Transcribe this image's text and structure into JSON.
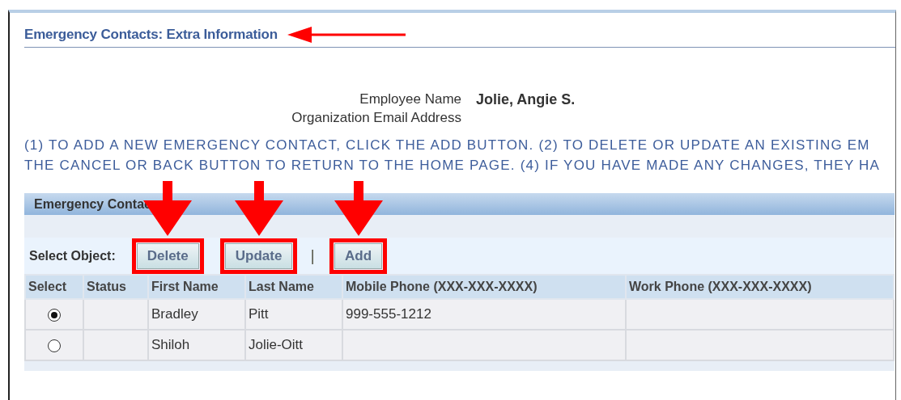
{
  "title": {
    "text": "Emergency Contacts: Extra Information",
    "highlighted": true
  },
  "employee": [
    {
      "label": "Employee Name",
      "value": "Jolie, Angie S."
    },
    {
      "label": "Organization Email Address"
    }
  ],
  "instructions": [
    "(1) TO ADD A NEW EMERGENCY CONTACT, CLICK THE ADD BUTTON. (2) TO DELETE OR UPDATE AN EXISTING EM",
    "THE CANCEL OR BACK BUTTON TO RETURN TO THE HOME PAGE. (4) IF YOU HAVE MADE ANY CHANGES, THEY HA"
  ],
  "section": {
    "title": "Emergency Contac"
  },
  "toolbar": {
    "label": "Select Object:",
    "buttons": [
      {
        "label": "Delete",
        "highlighted": true
      },
      {
        "label": "Update",
        "highlighted": true
      },
      {
        "label": "Add",
        "highlighted": true
      }
    ],
    "separator": "|"
  },
  "table": {
    "columns": [
      "Select",
      "Status",
      "First Name",
      "Last Name",
      "Mobile Phone (XXX-XXX-XXXX)",
      "Work Phone (XXX-XXX-XXXX)"
    ],
    "rows": [
      {
        "selected": true,
        "first_name": "Bradley",
        "last_name": "Pitt",
        "mobile": "999-555-1212"
      },
      {
        "selected": false,
        "first_name": "Shiloh",
        "last_name": "Jolie-Oitt"
      }
    ]
  }
}
